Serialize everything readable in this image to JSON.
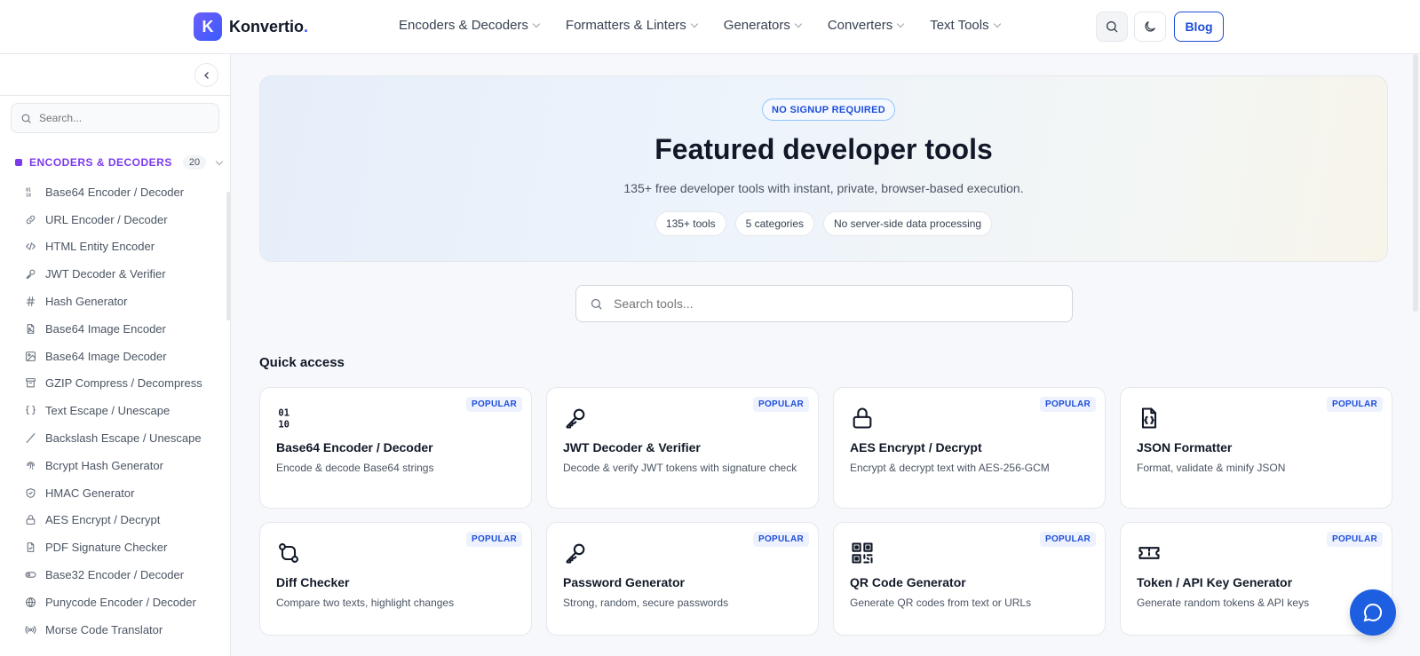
{
  "brand": {
    "mark": "K",
    "name": "Konvertio",
    "dot": "."
  },
  "nav": [
    "Encoders & Decoders",
    "Formatters & Linters",
    "Generators",
    "Converters",
    "Text Tools"
  ],
  "header": {
    "blog_label": "Blog"
  },
  "sidebar": {
    "search_placeholder": "Search...",
    "category": {
      "title": "ENCODERS & DECODERS",
      "count": "20"
    },
    "items": [
      {
        "label": "Base64 Encoder / Decoder",
        "icon": "binary-icon"
      },
      {
        "label": "URL Encoder / Decoder",
        "icon": "link-icon"
      },
      {
        "label": "HTML Entity Encoder",
        "icon": "code-icon"
      },
      {
        "label": "JWT Decoder & Verifier",
        "icon": "key-icon"
      },
      {
        "label": "Hash Generator",
        "icon": "hash-icon"
      },
      {
        "label": "Base64 Image Encoder",
        "icon": "file-image-icon"
      },
      {
        "label": "Base64 Image Decoder",
        "icon": "image-icon"
      },
      {
        "label": "GZIP Compress / Decompress",
        "icon": "archive-icon"
      },
      {
        "label": "Text Escape / Unescape",
        "icon": "braces-icon"
      },
      {
        "label": "Backslash Escape / Unescape",
        "icon": "slash-icon"
      },
      {
        "label": "Bcrypt Hash Generator",
        "icon": "fingerprint-icon"
      },
      {
        "label": "HMAC Generator",
        "icon": "shield-icon"
      },
      {
        "label": "AES Encrypt / Decrypt",
        "icon": "lock-icon"
      },
      {
        "label": "PDF Signature Checker",
        "icon": "file-check-icon"
      },
      {
        "label": "Base32 Encoder / Decoder",
        "icon": "toggle-icon"
      },
      {
        "label": "Punycode Encoder / Decoder",
        "icon": "globe-icon"
      },
      {
        "label": "Morse Code Translator",
        "icon": "radio-icon"
      }
    ]
  },
  "hero": {
    "badge": "NO SIGNUP REQUIRED",
    "title": "Featured developer tools",
    "subtitle": "135+ free developer tools with instant, private, browser-based execution.",
    "chips": [
      "135+ tools",
      "5 categories",
      "No server-side data processing"
    ]
  },
  "main_search": {
    "placeholder": "Search tools..."
  },
  "quick_access": {
    "title": "Quick access",
    "badge": "POPULAR",
    "cards": [
      {
        "title": "Base64 Encoder / Decoder",
        "desc": "Encode & decode Base64 strings",
        "icon": "binary-icon"
      },
      {
        "title": "JWT Decoder & Verifier",
        "desc": "Decode & verify JWT tokens with signature check",
        "icon": "key-icon"
      },
      {
        "title": "AES Encrypt / Decrypt",
        "desc": "Encrypt & decrypt text with AES-256-GCM",
        "icon": "lock-icon"
      },
      {
        "title": "JSON Formatter",
        "desc": "Format, validate & minify JSON",
        "icon": "file-json-icon"
      },
      {
        "title": "Diff Checker",
        "desc": "Compare two texts, highlight changes",
        "icon": "git-compare-icon"
      },
      {
        "title": "Password Generator",
        "desc": "Strong, random, secure passwords",
        "icon": "key-icon"
      },
      {
        "title": "QR Code Generator",
        "desc": "Generate QR codes from text or URLs",
        "icon": "qr-code-icon"
      },
      {
        "title": "Token / API Key Generator",
        "desc": "Generate random tokens & API keys",
        "icon": "ticket-icon"
      }
    ]
  },
  "colors": {
    "accent": "#1d4ed8",
    "category": "#7c3aed",
    "fab": "#1d5fe0"
  }
}
